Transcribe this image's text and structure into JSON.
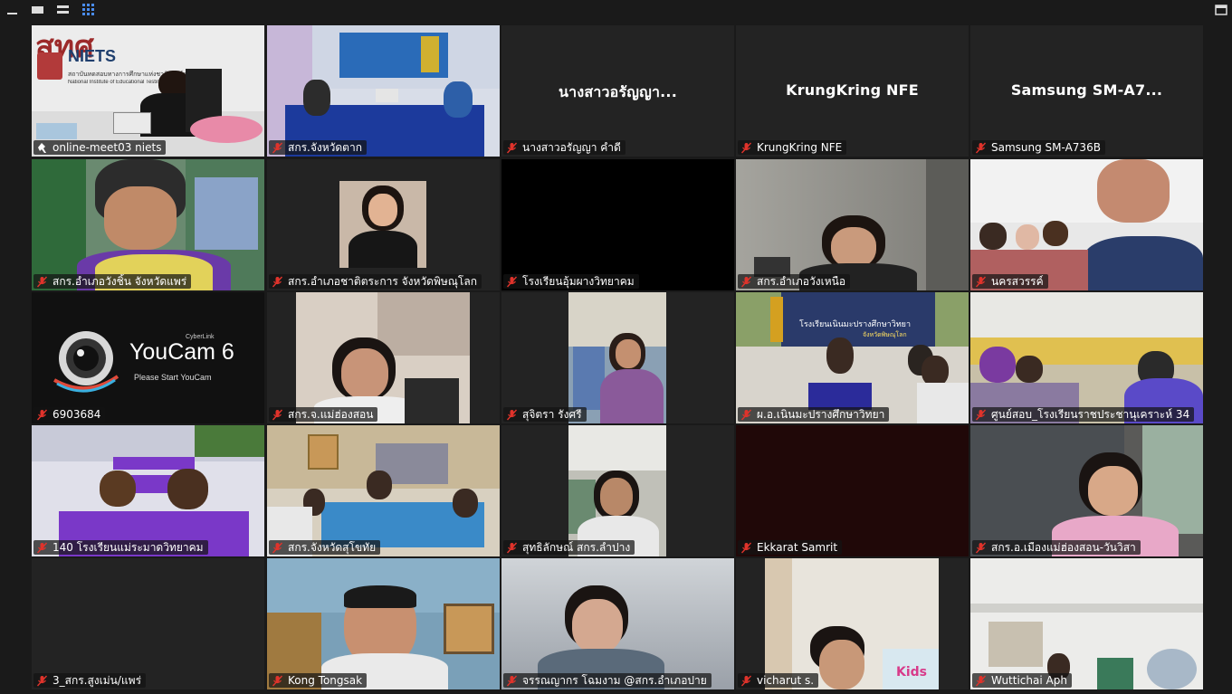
{
  "toolbar": {
    "minimize_icon": "minimize-icon",
    "chat_icon": "chat-icon",
    "menu_icon": "menu-icon",
    "gallery_icon": "gallery-grid-icon",
    "exit_fullscreen_icon": "exit-fullscreen-icon"
  },
  "colors": {
    "background": "#1a1a1a",
    "tile": "#232323",
    "active_border": "#e6df7a",
    "muted_mic": "#e0332b"
  },
  "participants": [
    {
      "name": "online-meet03 niets",
      "muted": false,
      "big": ""
    },
    {
      "name": "สกร.จังหวัดตาก",
      "muted": true,
      "big": ""
    },
    {
      "name": "นางสาวอรัญญา  คำดี",
      "muted": true,
      "big": "นางสาวอรัญญา..."
    },
    {
      "name": "KrungKring NFE",
      "muted": true,
      "big": "KrungKring NFE"
    },
    {
      "name": "Samsung SM-A736B",
      "muted": true,
      "big": "Samsung  SM-A7..."
    },
    {
      "name": "สกร.อำเภอวังชิ้น จังหวัดแพร่",
      "muted": true,
      "big": ""
    },
    {
      "name": "สกร.อำเภอชาติตระการ จังหวัดพิษณุโลก",
      "muted": true,
      "big": ""
    },
    {
      "name": "โรงเรียนอุ้มผางวิทยาคม",
      "muted": true,
      "big": ""
    },
    {
      "name": "สกร.อำเภอวังเหนือ",
      "muted": true,
      "big": ""
    },
    {
      "name": "นครสวรรค์",
      "muted": true,
      "big": ""
    },
    {
      "name": "6903684",
      "muted": true,
      "big": ""
    },
    {
      "name": "สกร.จ.แม่ฮ่องสอน",
      "muted": true,
      "big": ""
    },
    {
      "name": "สุจิตรา  รังศรี",
      "muted": true,
      "big": ""
    },
    {
      "name": "ผ.อ.เนินมะปรางศึกษาวิทยา",
      "muted": true,
      "big": ""
    },
    {
      "name": "ศูนย์สอบ_โรงเรียนราชประชานุเคราะห์ 34",
      "muted": true,
      "big": ""
    },
    {
      "name": "140 โรงเรียนแม่ระมาดวิทยาคม",
      "muted": true,
      "big": ""
    },
    {
      "name": "สกร.จังหวัดสุโขทัย",
      "muted": true,
      "big": ""
    },
    {
      "name": "สุทธิลักษณ์ สกร.ลำปาง",
      "muted": true,
      "big": ""
    },
    {
      "name": "Ekkarat Samrit",
      "muted": true,
      "big": ""
    },
    {
      "name": "สกร.อ.เมืองแม่ฮ่องสอน-วันวิสา",
      "muted": true,
      "big": ""
    },
    {
      "name": "3_สกร.สูงเม่น/แพร่",
      "muted": true,
      "big": ""
    },
    {
      "name": "Kong Tongsak",
      "muted": true,
      "big": ""
    },
    {
      "name": "จรรณญากร  โฉมงาม @สกร.อำเภอปาย",
      "muted": true,
      "big": ""
    },
    {
      "name": "vicharut  s.",
      "muted": true,
      "big": ""
    },
    {
      "name": "Wuttichai Aph",
      "muted": true,
      "big": ""
    }
  ],
  "niets_slide": {
    "logo_text": "สทศ",
    "short": "NIETS",
    "thai_name": "สถาบันทดสอบทางการศึกษาแห่งชาติ (องค์การมหาชน)",
    "eng_name": "National Institute of Educational Testing Service (Public Organization)"
  },
  "youcam": {
    "brand": "CyberLink",
    "title": "YouCam 6",
    "subtitle": "Please Start YouCam"
  },
  "school_banner": {
    "text": "โรงเรียนเนินมะปรางศึกษาวิทยา",
    "sub": "จังหวัดพิษณุโลก"
  },
  "wall_sign": {
    "text": "Kids"
  }
}
